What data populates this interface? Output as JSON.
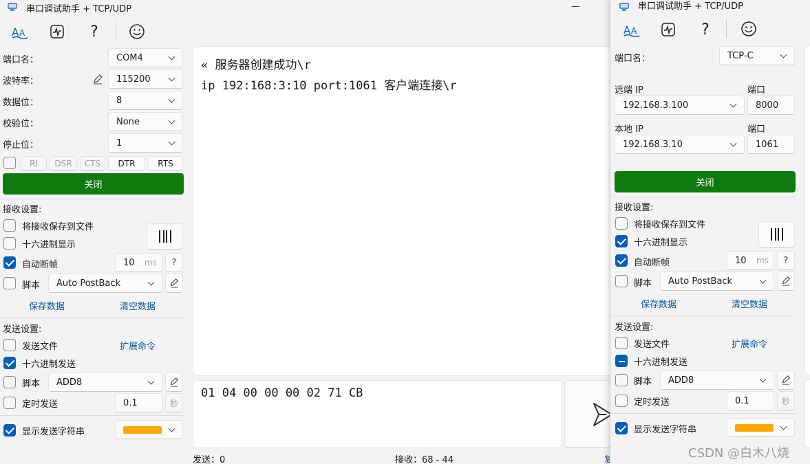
{
  "app": {
    "title": "串口调试助手 + TCP/UDP"
  },
  "serial_panel": {
    "port_label": "端口名：",
    "port_value": "COM4",
    "baud_label": "波特率：",
    "baud_value": "115200",
    "databits_label": "数据位：",
    "databits_value": "8",
    "parity_label": "校验位：",
    "parity_value": "None",
    "stopbits_label": "停止位：",
    "stopbits_value": "1",
    "signals": [
      "RI",
      "DSR",
      "CTS",
      "DTR",
      "RTS"
    ],
    "close_label": "关闭"
  },
  "receive": {
    "heading": "接收设置:",
    "save_to_file": "将接收保存到文件",
    "hex_display": "十六进制显示",
    "auto_frame": "自动断帧",
    "frame_ms_value": "10",
    "frame_ms_unit": "ms",
    "help": "?",
    "script": "脚本",
    "script_value": "Auto PostBack",
    "save_data": "保存数据",
    "clear_data": "清空数据",
    "pause_icon_label": "▯▯"
  },
  "send": {
    "heading": "发送设置:",
    "send_file": "发送文件",
    "ext_cmd": "扩展命令",
    "hex_send": "十六进制发送",
    "script": "脚本",
    "script_value": "ADD8",
    "timed_send": "定时发送",
    "timed_value": "0.1",
    "timed_unit": "秒",
    "show_send": "显示发送字符串"
  },
  "output": {
    "line1": "« 服务器创建成功\\r",
    "line2": "ip 192:168:3:10 port:1061 客户端连接\\r"
  },
  "input": {
    "text": "01 04 00 00 00 02 71 CB"
  },
  "status": {
    "sent": "发送：0",
    "received": "接收：68 - 44",
    "partial": "复"
  },
  "tcp_panel": {
    "port_label": "端口名：",
    "port_value": "TCP-C",
    "remote_ip_label": "远端 IP",
    "remote_ip_value": "192.168.3.100",
    "remote_port_label": "端口",
    "remote_port_value": "8000",
    "local_ip_label": "本地 IP",
    "local_ip_value": "192.168.3.10",
    "local_port_label": "端口",
    "local_port_value": "1061",
    "close_label": "关闭"
  },
  "watermark": "CSDN @白木八烧",
  "colors": {
    "accent": "#005fb8",
    "green": "#0f7b0f",
    "swatch": "#ffa800"
  }
}
